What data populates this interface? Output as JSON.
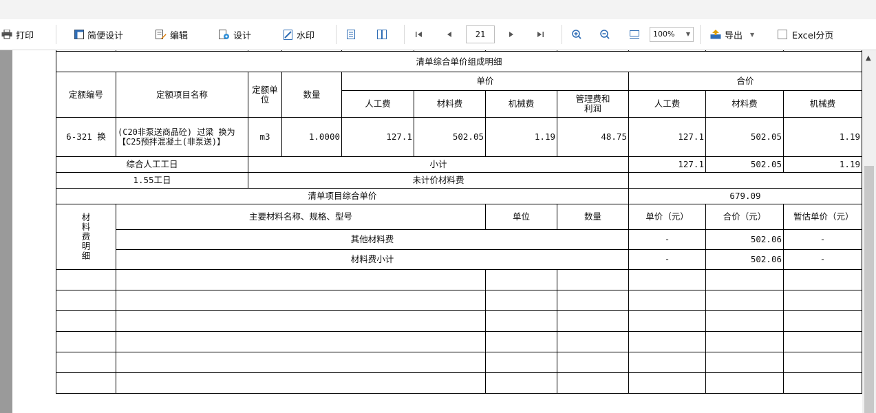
{
  "toolbar": {
    "print": "打印",
    "simple_design": "简便设计",
    "edit": "编辑",
    "design": "设计",
    "watermark": "水印",
    "page_number": "21",
    "zoom": "100%",
    "export": "导出",
    "excel_paging": "Excel分页"
  },
  "report": {
    "section_title": "清单综合单价组成明细",
    "headers": {
      "quota_code": "定额编号",
      "quota_name": "定额项目名称",
      "quota_unit": "定额单位",
      "quantity": "数量",
      "unit_price": "单价",
      "total_price": "合价",
      "labor": "人工费",
      "material": "材料费",
      "machine": "机械费",
      "mgmt": "管理费和利润"
    },
    "item": {
      "code": "6-321 换",
      "name": "(C20非泵送商品砼) 过梁 换为【C25预拌混凝土(非泵送)】",
      "unit": "m3",
      "quantity": "1.0000",
      "labor": "127.1",
      "material": "502.05",
      "machine": "1.19",
      "mgmt": "48.75",
      "total_labor": "127.1",
      "total_material": "502.05",
      "total_machine": "1.19"
    },
    "labor_day_label": "综合人工工日",
    "subtotal_label": "小计",
    "subtotal": {
      "labor": "127.1",
      "material": "502.05",
      "machine": "1.19"
    },
    "labor_days": "1.55工日",
    "unpriced_material_label": "未计价材料费",
    "composite_price_label": "清单项目综合单价",
    "composite_price": "679.09",
    "material_detail_label": "材料费明细",
    "material_headers": {
      "name": "主要材料名称、规格、型号",
      "unit": "单位",
      "qty": "数量",
      "unit_price": "单价（元）",
      "total": "合价（元）",
      "est_price": "暂估单价（元）"
    },
    "other_material": {
      "label": "其他材料费",
      "unit_price": "-",
      "total": "502.06",
      "est": "-"
    },
    "material_subtotal": {
      "label": "材料费小计",
      "unit_price": "-",
      "total": "502.06",
      "est": "-"
    }
  }
}
